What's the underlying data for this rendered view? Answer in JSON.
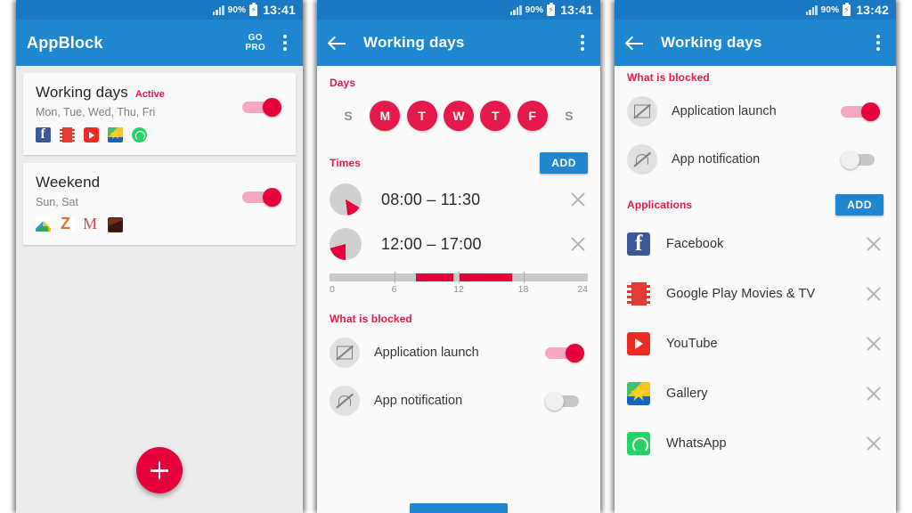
{
  "status_bar": {
    "battery_percent": "90%",
    "time_panel1": "13:41",
    "time_panel2": "13:41",
    "time_panel3": "13:42",
    "signal_icon": "signal-bars-icon",
    "battery_icon": "battery-charging-icon"
  },
  "colors": {
    "app_bar_blue": "#1f86d0",
    "status_bar_blue": "#1b79c4",
    "accent_crimson": "#e5003c",
    "section_label_red": "#e5194b",
    "toggle_track_pink": "#f7a8c1",
    "toggle_off_gray": "#c7c7c7",
    "page_background": "#ececec",
    "card_background": "#fafafa"
  },
  "panel1": {
    "app_title": "AppBlock",
    "go_pro_line1": "GO",
    "go_pro_line2": "PRO",
    "overflow_icon": "kebab-menu-icon",
    "fab_icon": "plus-icon",
    "profiles": [
      {
        "name": "Working days",
        "badge": "Active",
        "days": "Mon, Tue, Wed, Thu, Fri",
        "enabled": true,
        "apps": [
          "facebook-icon",
          "google-play-movies-icon",
          "youtube-icon",
          "gallery-icon",
          "whatsapp-icon"
        ]
      },
      {
        "name": "Weekend",
        "badge": "",
        "days": "Sun, Sat",
        "enabled": true,
        "apps": [
          "google-drive-icon",
          "zedge-icon",
          "gmail-icon",
          "dark-app-icon"
        ]
      }
    ]
  },
  "panel2": {
    "title": "Working days",
    "back_icon": "back-arrow-icon",
    "overflow_icon": "kebab-menu-icon",
    "days_section": {
      "label": "Days",
      "days": [
        {
          "letter": "S",
          "selected": false
        },
        {
          "letter": "M",
          "selected": true
        },
        {
          "letter": "T",
          "selected": true
        },
        {
          "letter": "W",
          "selected": true
        },
        {
          "letter": "T",
          "selected": true
        },
        {
          "letter": "F",
          "selected": true
        },
        {
          "letter": "S",
          "selected": false
        }
      ]
    },
    "times_section": {
      "label": "Times",
      "add_label": "ADD",
      "entries": [
        {
          "range": "08:00 – 11:30",
          "start_hour": 8.0,
          "end_hour": 11.5,
          "remove_icon": "close-icon"
        },
        {
          "range": "12:00 – 17:00",
          "start_hour": 12.0,
          "end_hour": 17.0,
          "remove_icon": "close-icon"
        }
      ],
      "timeline_ticks": [
        "0",
        "6",
        "12",
        "18",
        "24"
      ],
      "timeline_min": 0,
      "timeline_max": 24
    },
    "blocked_section": {
      "label": "What is blocked",
      "items": [
        {
          "label": "Application launch",
          "icon": "app-launch-blocked-icon",
          "enabled": true
        },
        {
          "label": "App notification",
          "icon": "notification-blocked-icon",
          "enabled": false
        }
      ]
    }
  },
  "panel3": {
    "title": "Working days",
    "back_icon": "back-arrow-icon",
    "overflow_icon": "kebab-menu-icon",
    "blocked_section": {
      "label": "What is blocked",
      "items": [
        {
          "label": "Application launch",
          "icon": "app-launch-blocked-icon",
          "enabled": true
        },
        {
          "label": "App notification",
          "icon": "notification-blocked-icon",
          "enabled": false
        }
      ]
    },
    "applications_section": {
      "label": "Applications",
      "add_label": "ADD",
      "apps": [
        {
          "name": "Facebook",
          "icon": "facebook-icon",
          "remove_icon": "close-icon"
        },
        {
          "name": "Google Play Movies & TV",
          "icon": "google-play-movies-icon",
          "remove_icon": "close-icon"
        },
        {
          "name": "YouTube",
          "icon": "youtube-icon",
          "remove_icon": "close-icon"
        },
        {
          "name": "Gallery",
          "icon": "gallery-icon",
          "remove_icon": "close-icon"
        },
        {
          "name": "WhatsApp",
          "icon": "whatsapp-icon",
          "remove_icon": "close-icon"
        }
      ]
    }
  }
}
